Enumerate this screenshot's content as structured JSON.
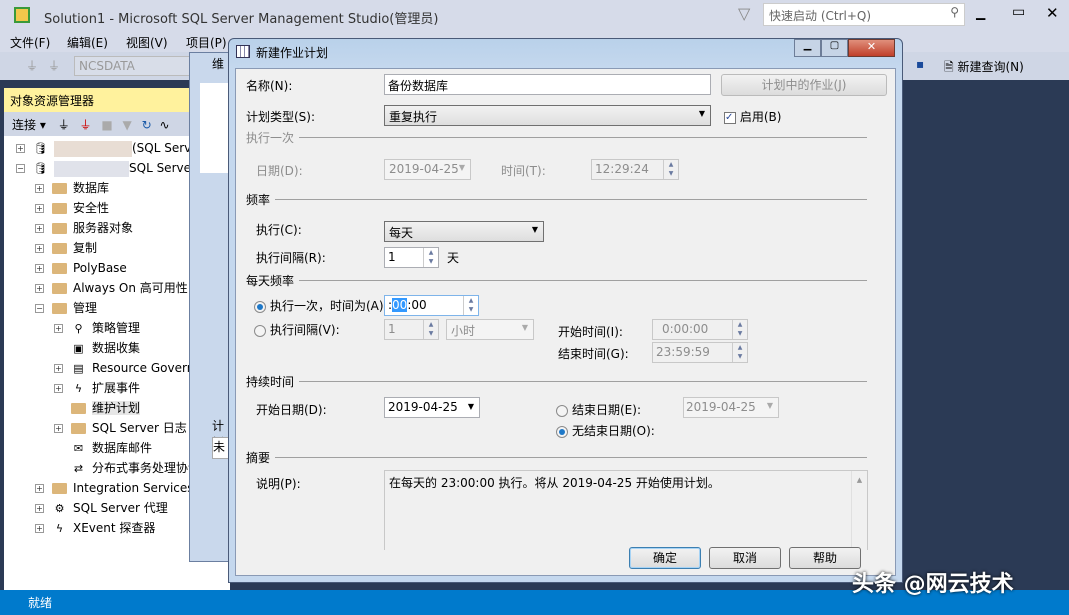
{
  "app": {
    "title": "Solution1 - Microsoft SQL Server Management Studio(管理员)",
    "quick_launch_placeholder": "快速启动 (Ctrl+Q)",
    "status": "就绪",
    "watermark": "头条 @网云技术"
  },
  "menu": [
    "文件(F)",
    "编辑(E)",
    "视图(V)",
    "项目(P)"
  ],
  "toolbar": {
    "db": "NCSDATA",
    "new_query": "新建查询(N)"
  },
  "object_explorer": {
    "title": "对象资源管理器",
    "connect": "连接",
    "servers": [
      "(SQL Server",
      "SQL Server"
    ],
    "nodes": [
      "数据库",
      "安全性",
      "服务器对象",
      "复制",
      "PolyBase",
      "Always On 高可用性",
      "管理"
    ],
    "management_children": [
      "策略管理",
      "数据收集",
      "Resource Governor",
      "扩展事件",
      "维护计划",
      "SQL Server 日志",
      "数据库邮件",
      "分布式事务处理协调器"
    ],
    "bottom_nodes": [
      "Integration Services",
      "SQL Server 代理",
      "XEvent 探查器"
    ]
  },
  "background_dialog": {
    "title": "维",
    "label": "计划",
    "value": "未"
  },
  "dialog": {
    "title": "新建作业计划",
    "name_label": "名称(N):",
    "name_value": "备份数据库",
    "jobs_button": "计划中的作业(J)",
    "type_label": "计划类型(S):",
    "type_value": "重复执行",
    "enabled_label": "启用(B)",
    "enabled": true,
    "once": {
      "group": "执行一次",
      "date_label": "日期(D):",
      "date_value": "2019-04-25",
      "time_label": "时间(T):",
      "time_value": "12:29:24"
    },
    "frequency": {
      "group": "频率",
      "occurs_label": "执行(C):",
      "occurs_value": "每天",
      "recurs_label": "执行间隔(R):",
      "recurs_value": "1",
      "recurs_unit": "天"
    },
    "daily": {
      "group": "每天频率",
      "once_label": "执行一次，时间为(A):",
      "once_value_prefix": ":",
      "once_value_selected": "00",
      "once_value_suffix": ":00",
      "interval_label": "执行间隔(V):",
      "interval_value": "1",
      "interval_unit": "小时",
      "start_label": "开始时间(I):",
      "start_value": "0:00:00",
      "end_label": "结束时间(G):",
      "end_value": "23:59:59",
      "selected": "once"
    },
    "duration": {
      "group": "持续时间",
      "start_label": "开始日期(D):",
      "start_value": "2019-04-25",
      "end_label": "结束日期(E):",
      "end_value": "2019-04-25",
      "no_end_label": "无结束日期(O):",
      "selected": "no_end"
    },
    "summary": {
      "group": "摘要",
      "desc_label": "说明(P):",
      "desc_value": "在每天的 23:00:00 执行。将从 2019-04-25 开始使用计划。"
    },
    "ok": "确定",
    "cancel": "取消",
    "help": "帮助"
  }
}
